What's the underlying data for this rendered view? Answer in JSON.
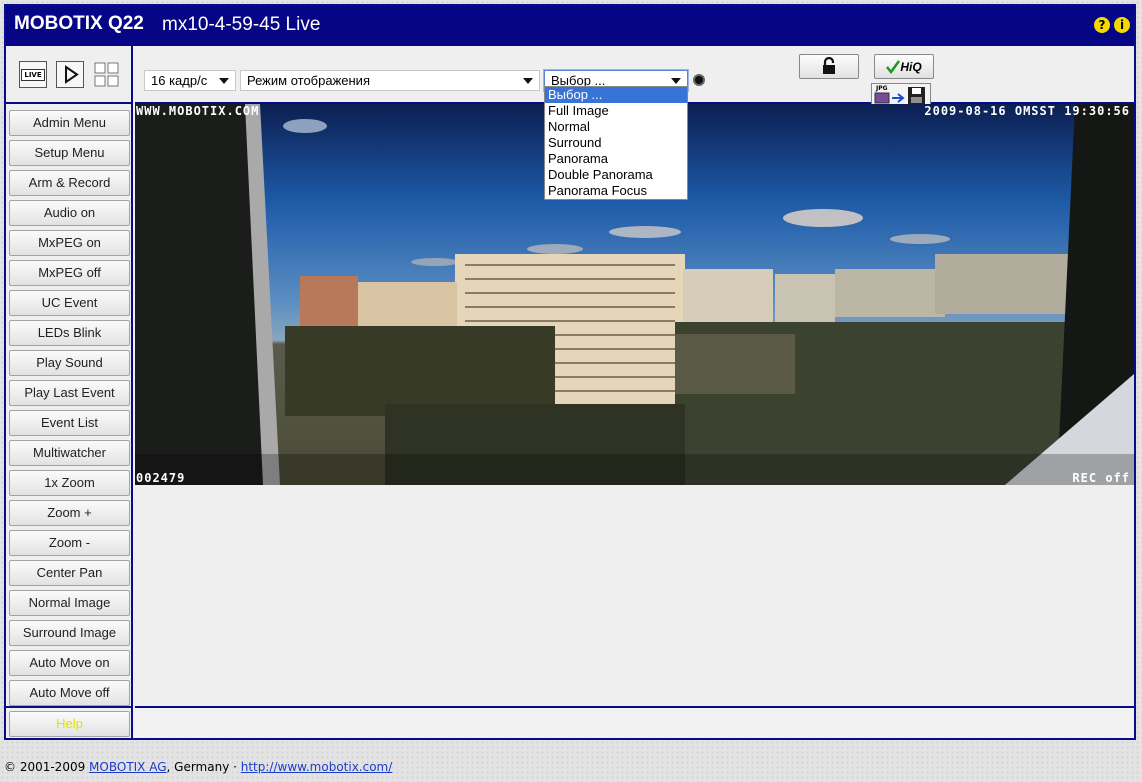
{
  "header": {
    "model": "MOBOTIX Q22",
    "camera_name": "mx10-4-59-45 Live",
    "help_icon": "?",
    "info_icon": "i"
  },
  "icons": {
    "live": "LIVE",
    "hiq": "HiQ",
    "jpg": "JPG"
  },
  "toolbar": {
    "framerate": "16 кадр/с",
    "display_mode": "Режим отображения",
    "view_select": "Выбор ...",
    "view_options": [
      "Выбор ...",
      "Full Image",
      "Normal",
      "Surround",
      "Panorama",
      "Double Panorama",
      "Panorama Focus"
    ]
  },
  "sidebar": {
    "buttons": [
      "Admin Menu",
      "Setup Menu",
      "Arm & Record",
      "Audio on",
      "MxPEG on",
      "MxPEG off",
      "UC Event",
      "LEDs Blink",
      "Play Sound",
      "Play Last Event",
      "Event List",
      "Multiwatcher",
      "1x Zoom",
      "Zoom +",
      "Zoom -",
      "Center Pan",
      "Normal Image",
      "Surround Image",
      "Auto Move on",
      "Auto Move off"
    ],
    "help": "Help"
  },
  "overlay": {
    "url": "WWW.MOBOTIX.COM",
    "timestamp": "2009-08-16 OMSST 19:30:56",
    "frame_counter": "002479",
    "rec_status": "REC off"
  },
  "footer": {
    "copyright": "© 2001-2009 ",
    "company_link": "MOBOTIX AG",
    "country": ", Germany · ",
    "website_link": "http://www.mobotix.com/"
  },
  "colors": {
    "brand": "#050585",
    "dropdown_highlight": "#3874d8"
  }
}
